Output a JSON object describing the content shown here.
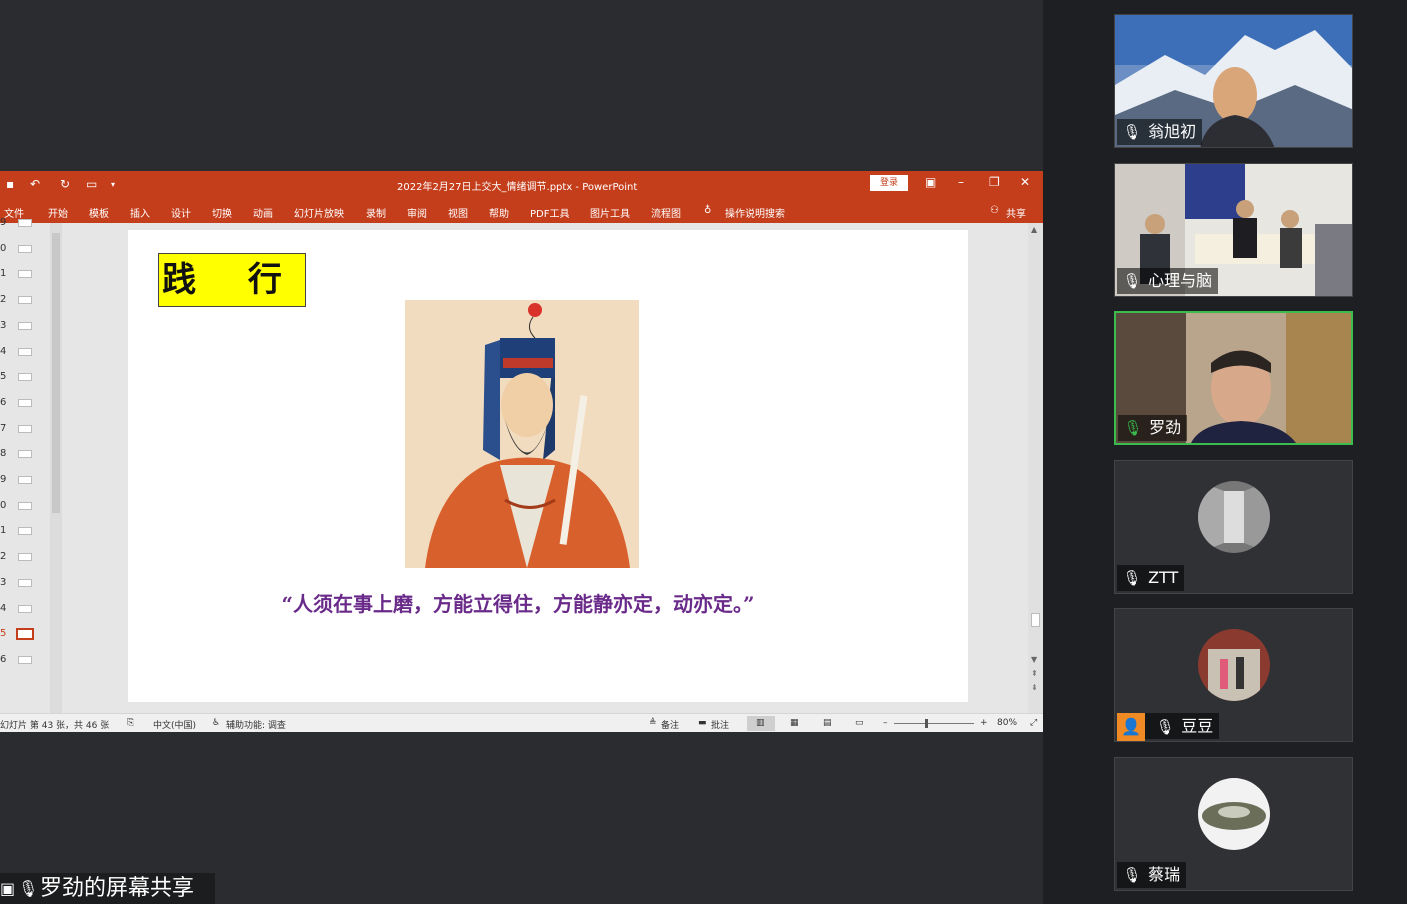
{
  "ppt": {
    "window_title": "2022年2月27日上交大_情绪调节.pptx  -  PowerPoint",
    "login_label": "登录",
    "quick_access": [
      "save-icon",
      "undo-icon",
      "redo-icon",
      "present-icon"
    ],
    "ribbon_tabs": [
      "文件",
      "开始",
      "模板",
      "插入",
      "设计",
      "切换",
      "动画",
      "幻灯片放映",
      "录制",
      "审阅",
      "视图",
      "帮助",
      "PDF工具",
      "图片工具",
      "流程图"
    ],
    "tell_me": "操作说明搜索",
    "share_label": "共享",
    "thumbnails": [
      "9",
      "0",
      "1",
      "2",
      "3",
      "4",
      "5",
      "6",
      "7",
      "8",
      "9",
      "0",
      "1",
      "2",
      "3",
      "4",
      "5",
      "6"
    ],
    "active_thumbnail_index": 16,
    "slide": {
      "title": "践 行",
      "quote": "“人须在事上磨，方能立得住，方能静亦定，动亦定。”"
    },
    "status": {
      "slide_info": "幻灯片 第 43 张，共 46 张",
      "language": "中文(中国)",
      "accessibility": "辅助功能: 调查",
      "notes": "备注",
      "comments": "批注",
      "zoom": "80%"
    },
    "colors": {
      "accent": "#c43e1c",
      "quote": "#6a2a8a",
      "title_bg": "#ffff00"
    }
  },
  "screen_share_label": "罗劲的屏幕共享",
  "participants": [
    {
      "name": "翁旭初",
      "muted": true
    },
    {
      "name": "心理与脑",
      "muted": true
    },
    {
      "name": "罗劲",
      "muted": false
    },
    {
      "name": "ZTT",
      "muted": true
    },
    {
      "name": "豆豆",
      "muted": true
    },
    {
      "name": "蔡瑞",
      "muted": true
    }
  ]
}
